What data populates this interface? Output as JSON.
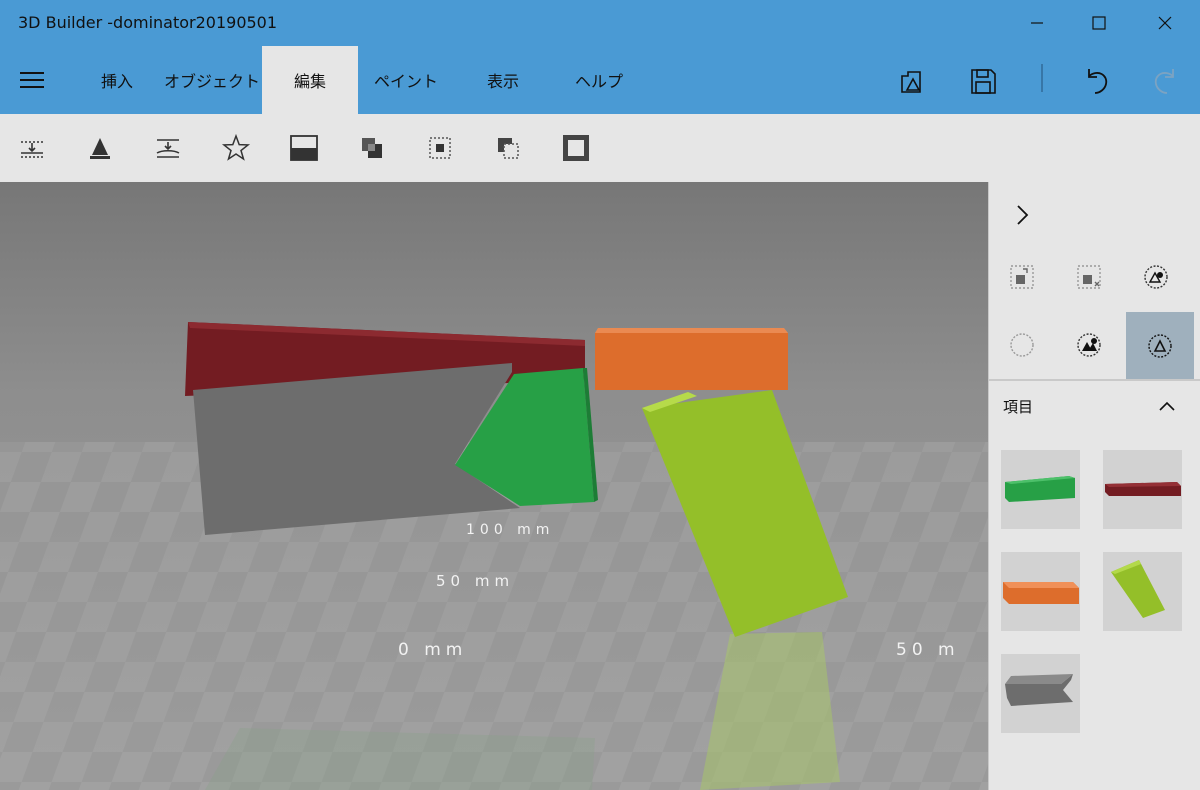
{
  "app": {
    "title": "3D Builder -dominator20190501"
  },
  "window_controls": {
    "minimize": "minimize",
    "maximize": "maximize",
    "close": "close"
  },
  "tabs": [
    {
      "label": "挿入",
      "active": false
    },
    {
      "label": "オブジェクト",
      "active": false
    },
    {
      "label": "編集",
      "active": true
    },
    {
      "label": "ペイント",
      "active": false
    },
    {
      "label": "表示",
      "active": false
    },
    {
      "label": "ヘルプ",
      "active": false
    }
  ],
  "quick_actions": [
    "render-icon",
    "save-icon",
    "undo-icon",
    "redo-icon"
  ],
  "tools": [
    "split-icon",
    "extrude-icon",
    "lay-flat-icon",
    "star-icon",
    "fill-half-icon",
    "merge-icon",
    "select-center-icon",
    "subtract-icon",
    "border-icon"
  ],
  "viewport": {
    "ruler_labels": [
      "100 mm",
      "50 mm",
      "0 mm",
      "50 m"
    ],
    "object_colors": {
      "dark_red": "#731c22",
      "gray": "#6d6d6d",
      "green": "#27a046",
      "orange": "#dd6d2c",
      "lime": "#94bf29"
    }
  },
  "panel": {
    "items_title": "項目",
    "thumbnails": [
      "green-bar",
      "dark-red-bar",
      "orange-bar",
      "lime-bar",
      "gray-plate"
    ]
  },
  "colors": {
    "title_bar": "#4a9ad4",
    "ribbon": "#e6e6e6",
    "selected_panel_button": "#9fb0bd"
  }
}
